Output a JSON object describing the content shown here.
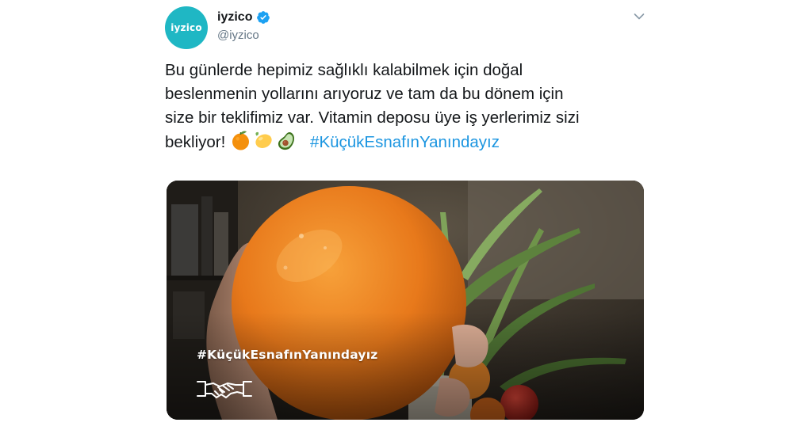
{
  "author": {
    "avatar_text": "iyzico",
    "display_name": "iyzico",
    "handle": "@iyzico",
    "verified": true
  },
  "tweet": {
    "lines": [
      "Bu günlerde hepimiz sağlıklı kalabilmek için doğal",
      "beslenmenin yollarını arıyoruz ve tam da bu dönem için",
      "size bir teklifimiz var. Vitamin deposu üye iş yerlerimiz sizi",
      "bekliyor!"
    ],
    "emojis": [
      "tangerine-emoji",
      "lemon-emoji",
      "avocado-emoji"
    ],
    "hashtag": "#KüçükEsnafınYanındayız"
  },
  "media": {
    "overlay_hashtag": "#KüçükEsnafınYanındayız",
    "overlay_icon": "handshake-icon"
  },
  "colors": {
    "brand": "#1fb7c4",
    "hashtag": "#1b95e0",
    "handle": "#657786",
    "verified": "#1da1f2"
  }
}
